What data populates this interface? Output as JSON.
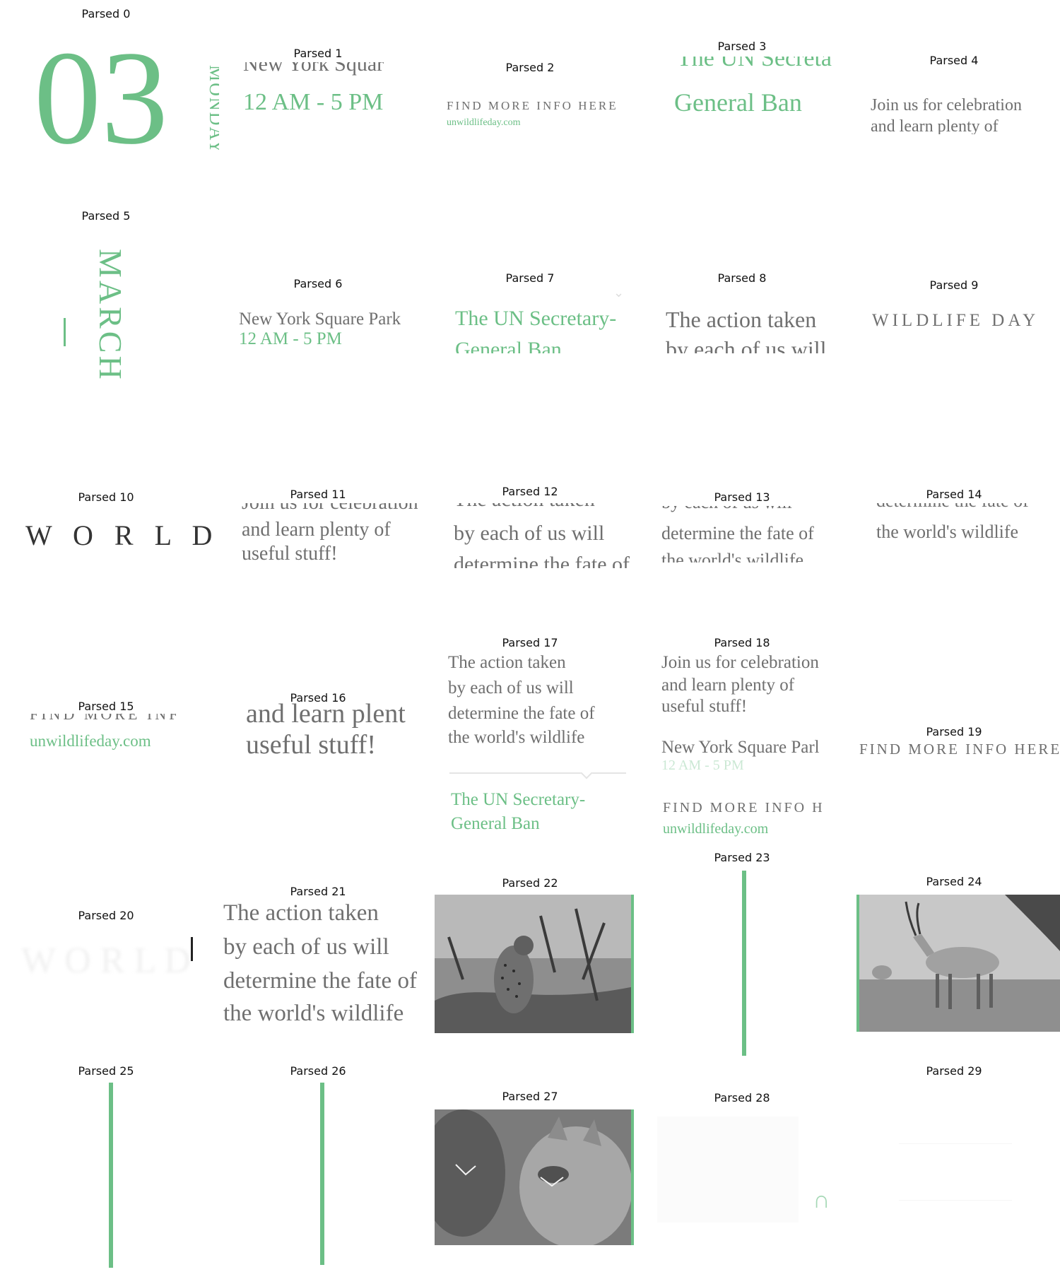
{
  "labels": [
    "Parsed 0",
    "Parsed 1",
    "Parsed 2",
    "Parsed 3",
    "Parsed 4",
    "Parsed 5",
    "Parsed 6",
    "Parsed 7",
    "Parsed 8",
    "Parsed 9",
    "Parsed 10",
    "Parsed 11",
    "Parsed 12",
    "Parsed 13",
    "Parsed 14",
    "Parsed 15",
    "Parsed 16",
    "Parsed 17",
    "Parsed 18",
    "Parsed 19",
    "Parsed 20",
    "Parsed 21",
    "Parsed 22",
    "Parsed 23",
    "Parsed 24",
    "Parsed 25",
    "Parsed 26",
    "Parsed 27",
    "Parsed 28",
    "Parsed 29"
  ],
  "text": {
    "day_number": "03",
    "month_vertical": "MONDAY",
    "month": "MARCH",
    "location": "New York Square Park",
    "location_cut": "New York Squar",
    "location_cut2": "New York Square Parl",
    "time": "12 AM - 5 PM",
    "find_more": "FIND MORE INFO HERE",
    "find_more_cut": "FIND MORE INFO H",
    "url": "unwildlifeday.com",
    "un_title_1": "The UN Secretary-",
    "un_title_2": "General Ban",
    "un_title_cut": "The UN Secreta",
    "join_1": "Join us for celebration",
    "join_2": "and learn plenty of",
    "join_3": "useful stuff!",
    "action_1": "The action taken",
    "action_2": "by each of us will",
    "action_3": "determine the fate of",
    "action_4": "the world's wildlife",
    "wildlife_day": "WILDLIFE DAY",
    "world": "W O R L D",
    "and_learn_cut": "and learn plent",
    "useful": "useful stuff!",
    "find_more_partial": "FIND MORE INF"
  },
  "colors": {
    "accent": "#6cbf86",
    "text": "#6f6f6f",
    "dark": "#333333"
  }
}
